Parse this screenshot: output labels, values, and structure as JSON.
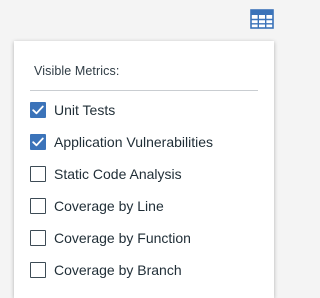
{
  "toolbar": {
    "columns_icon": "table-columns-icon"
  },
  "panel": {
    "title": "Visible Metrics:",
    "options": [
      {
        "label": "Unit Tests",
        "checked": true
      },
      {
        "label": "Application Vulnerabilities",
        "checked": true
      },
      {
        "label": "Static Code Analysis",
        "checked": false
      },
      {
        "label": "Coverage by Line",
        "checked": false
      },
      {
        "label": "Coverage by Function",
        "checked": false
      },
      {
        "label": "Coverage by Branch",
        "checked": false
      }
    ]
  },
  "colors": {
    "accent": "#3b73b9",
    "checkbox_border": "#3d4b55",
    "text": "#1f2d36",
    "background": "#f4f4f4"
  }
}
